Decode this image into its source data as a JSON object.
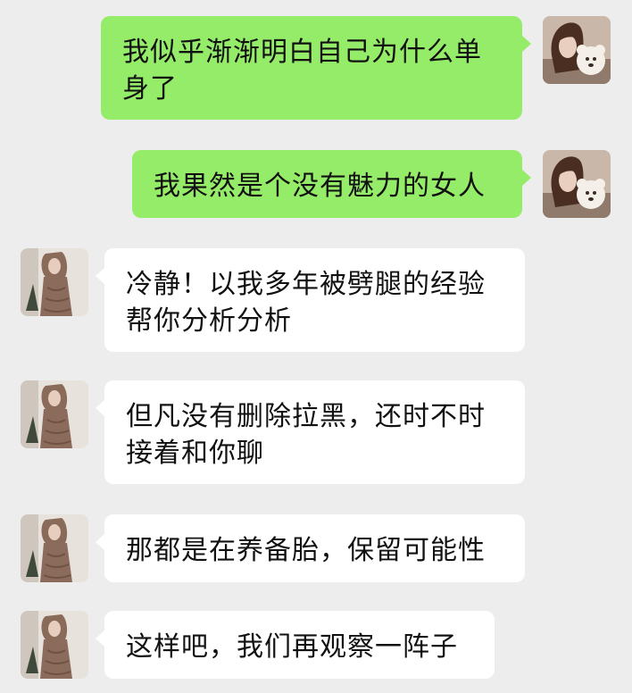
{
  "colors": {
    "background": "#ededed",
    "sent_bubble": "#95ec69",
    "received_bubble": "#ffffff",
    "text": "#111111"
  },
  "messages": [
    {
      "sender": "me",
      "text": "我似乎渐渐明白自己为什么单身了"
    },
    {
      "sender": "me",
      "text": "我果然是个没有魅力的女人"
    },
    {
      "sender": "friend",
      "text": "冷静！以我多年被劈腿的经验帮你分析分析"
    },
    {
      "sender": "friend",
      "text": "但凡没有删除拉黑，还时不时接着和你聊"
    },
    {
      "sender": "friend",
      "text": "那都是在养备胎，保留可能性"
    },
    {
      "sender": "friend",
      "text": "这样吧，我们再观察一阵子"
    }
  ]
}
